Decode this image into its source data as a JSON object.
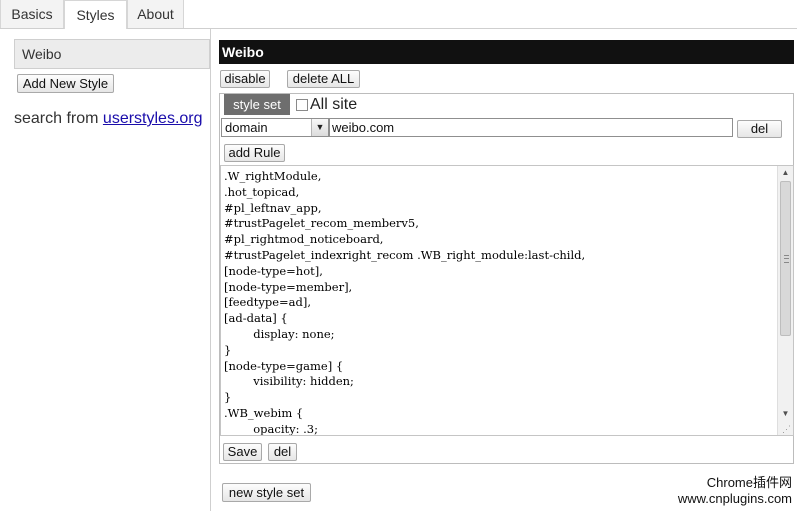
{
  "tabs": [
    {
      "label": "Basics",
      "active": false
    },
    {
      "label": "Styles",
      "active": true
    },
    {
      "label": "About",
      "active": false
    }
  ],
  "sidebar": {
    "selected_style": "Weibo",
    "add_new_label": "Add New Style",
    "search_prefix": "search from ",
    "search_link": "userstyles.org"
  },
  "editor": {
    "style_name": "Weibo",
    "disable_label": "disable",
    "delete_all_label": "delete ALL",
    "style_set_tab": "style set",
    "all_site_label": "All site",
    "all_site_checked": false,
    "rule_type": "domain",
    "rule_value": "weibo.com",
    "del_rule_label": "del",
    "add_rule_label": "add Rule",
    "css_code": ".W_rightModule,\n.hot_topicad,\n#pl_leftnav_app,\n#trustPagelet_recom_memberv5,\n#pl_rightmod_noticeboard,\n#trustPagelet_indexright_recom .WB_right_module:last-child,\n[node-type=hot],\n[node-type=member],\n[feedtype=ad],\n[ad-data] {\n        display: none;\n}\n[node-type=game] {\n        visibility: hidden;\n}\n.WB_webim {\n        opacity: .3;\n}",
    "save_label": "Save",
    "del_label": "del",
    "new_style_set_label": "new style set"
  },
  "watermark": {
    "line1": "Chrome插件网",
    "line2": "www.cnplugins.com"
  },
  "icons": {
    "select_arrow": "chevron-down-icon",
    "scroll_up": "scroll-up-icon",
    "scroll_down": "scroll-down-icon"
  }
}
